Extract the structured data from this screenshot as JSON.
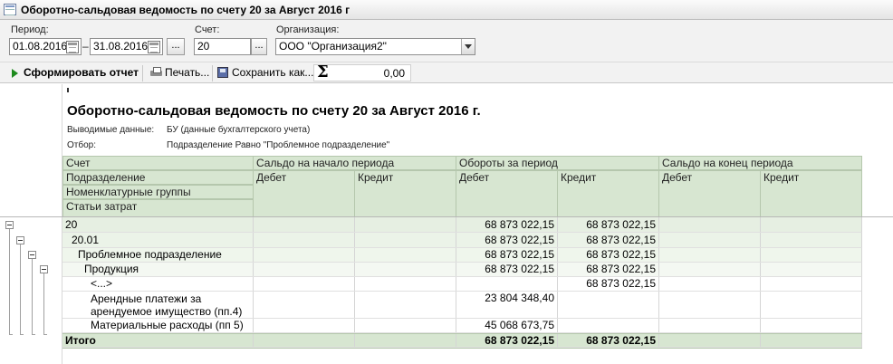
{
  "window": {
    "title": "Оборотно-сальдовая ведомость по счету 20 за Август 2016 г"
  },
  "params": {
    "period_label": "Период:",
    "date_from": "01.08.2016",
    "dash": "–",
    "date_to": "31.08.2016",
    "ellipsis_button": "...",
    "account_label": "Счет:",
    "account_value": "20",
    "org_label": "Организация:",
    "org_value": "ООО \"Организация2\""
  },
  "toolbar": {
    "generate_label": "Сформировать отчет",
    "print_label": "Печать...",
    "save_label": "Сохранить как...",
    "sum_value": "0,00"
  },
  "report": {
    "marker": "(",
    "title": "Оборотно-сальдовая ведомость по счету 20 за Август 2016 г.",
    "output_label": "Выводимые данные:",
    "output_value": "БУ (данные бухгалтерского учета)",
    "filter_label": "Отбор:",
    "filter_value": "Подразделение Равно \"Проблемное подразделение\"",
    "headers": {
      "account": "Счет",
      "department": "Подразделение",
      "nomenclature": "Номенклатурные группы",
      "cost_items": "Статьи затрат",
      "opening": "Сальдо на начало периода",
      "turnover": "Обороты за период",
      "closing": "Сальдо на конец периода",
      "debit": "Дебет",
      "credit": "Кредит"
    },
    "rows": [
      {
        "label": "20",
        "turn_debit": "68 873 022,15",
        "turn_credit": "68 873 022,15"
      },
      {
        "label": "20.01",
        "turn_debit": "68 873 022,15",
        "turn_credit": "68 873 022,15"
      },
      {
        "label": "Проблемное подразделение",
        "turn_debit": "68 873 022,15",
        "turn_credit": "68 873 022,15"
      },
      {
        "label": "Продукция",
        "turn_debit": "68 873 022,15",
        "turn_credit": "68 873 022,15"
      },
      {
        "label": "<...>",
        "turn_debit": "",
        "turn_credit": "68 873 022,15"
      },
      {
        "label_line1": "Арендные платежи за",
        "label_line2": "арендуемое имущество (пп.4)",
        "turn_debit": "23 804 348,40",
        "turn_credit": ""
      },
      {
        "label": "Материальные расходы (пп 5)",
        "turn_debit": "45 068 673,75",
        "turn_credit": ""
      }
    ],
    "total": {
      "label": "Итого",
      "turn_debit": "68 873 022,15",
      "turn_credit": "68 873 022,15"
    }
  }
}
